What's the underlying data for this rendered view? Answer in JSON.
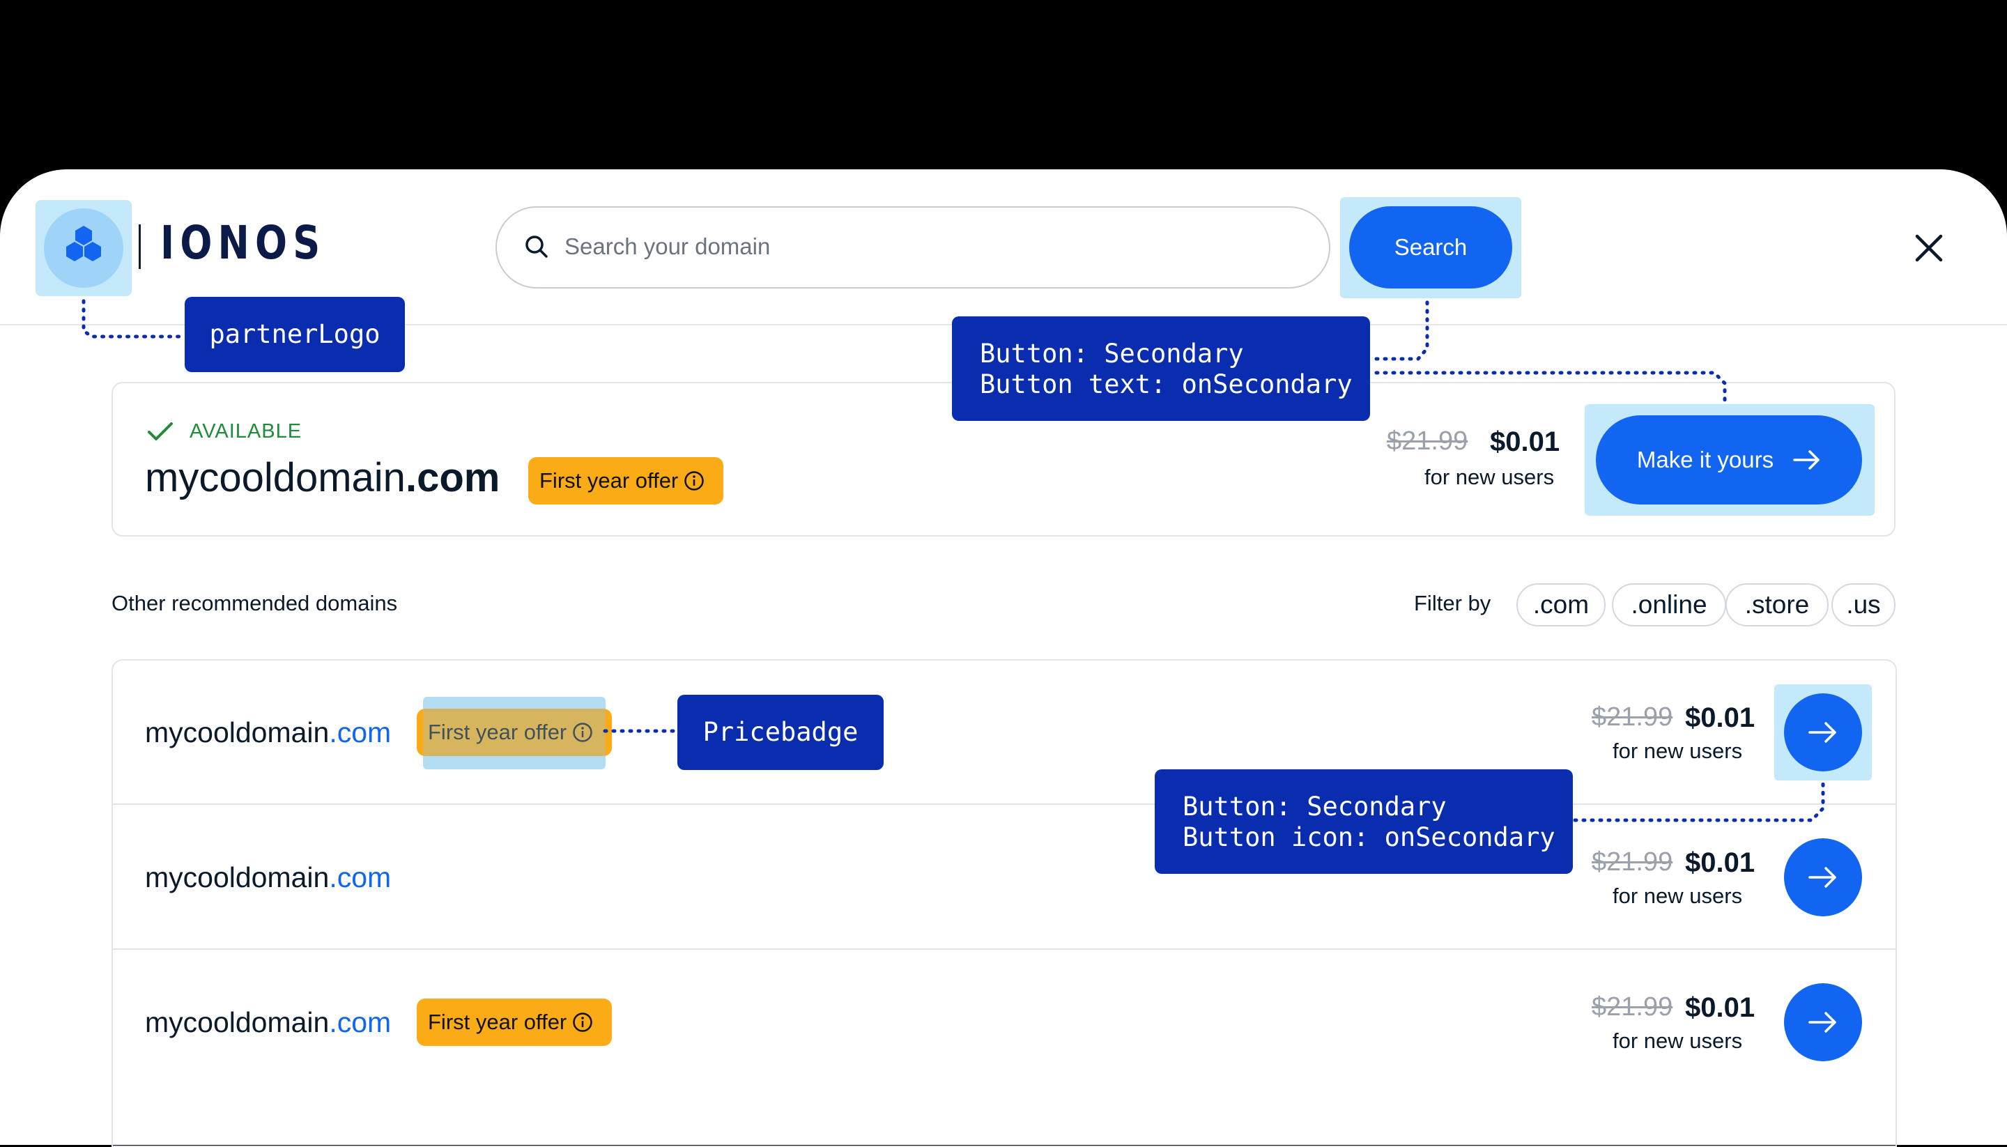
{
  "header": {
    "logo_text": "IONOS",
    "search_placeholder": "Search your domain",
    "search_button": "Search"
  },
  "main_result": {
    "status": "AVAILABLE",
    "domain_name": "mycooldomain",
    "domain_tld": ".com",
    "badge": "First year offer",
    "old_price": "$21.99",
    "new_price": "$0.01",
    "price_note": "for new users",
    "cta_label": "Make it yours"
  },
  "recommendations": {
    "title": "Other recommended domains",
    "filter_label": "Filter by",
    "filters": [
      ".com",
      ".online",
      ".store",
      ".us"
    ],
    "rows": [
      {
        "name": "mycooldomain",
        "tld": ".com",
        "badge": "First year offer",
        "old_price": "$21.99",
        "new_price": "$0.01",
        "price_note": "for new users"
      },
      {
        "name": "mycooldomain",
        "tld": ".com",
        "badge": "",
        "old_price": "$21.99",
        "new_price": "$0.01",
        "price_note": "for new users"
      },
      {
        "name": "mycooldomain",
        "tld": ".com",
        "badge": "First year offer",
        "old_price": "$21.99",
        "new_price": "$0.01",
        "price_note": "for new users"
      }
    ]
  },
  "annotations": {
    "partner_logo": "partnerLogo",
    "search_button_note": "Button: Secondary\nButton text: onSecondary",
    "pricebadge": "Pricebadge",
    "arrow_button_note": "Button: Secondary\nButton icon: onSecondary"
  },
  "colors": {
    "primary": "#1265f0",
    "badge": "#fbab16",
    "available": "#1f8c3a",
    "annotation": "#0a2db0",
    "highlight": "#c4e9fb"
  },
  "icons": [
    "logo-hexagons-icon",
    "search-icon",
    "close-icon",
    "check-icon",
    "info-icon",
    "arrow-right-icon"
  ]
}
